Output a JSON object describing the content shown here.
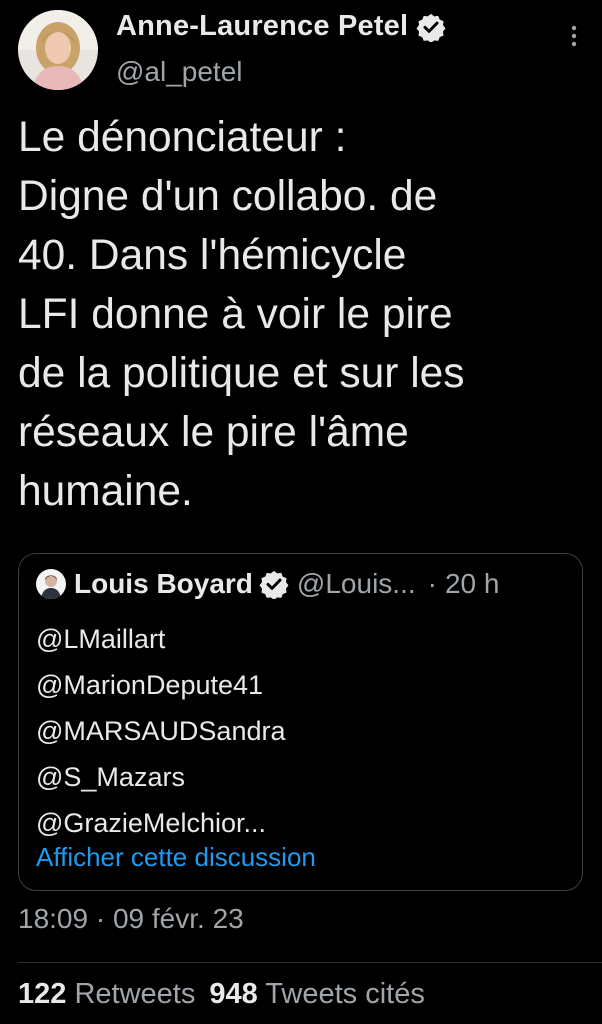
{
  "colors": {
    "background": "#000000",
    "text": "#e7e9ea",
    "secondary": "#a0a5aa",
    "link": "#1d9bf0",
    "border": "#3b3f44"
  },
  "tweet": {
    "author": {
      "name": "Anne-Laurence Petel",
      "handle": "@al_petel",
      "verified": true,
      "avatar_icon": "avatar-photo"
    },
    "more_icon": "more-vertical-icon",
    "text": "Le dénonciateur :\nDigne d'un collabo. de\n40. Dans l'hémicycle\nLFI donne à voir le pire\nde la politique et sur les\nréseaux le pire l'âme\nhumaine.",
    "quote": {
      "author_name": "Louis Boyard",
      "handle": "@Louis...",
      "separator": "·",
      "time": "20 h",
      "verified": true,
      "lines": [
        "@LMaillart",
        "@MarionDepute41",
        "@MARSAUDSandra",
        "@S_Mazars",
        "@GrazieMelchior..."
      ],
      "show_thread_label": "Afficher cette discussion"
    },
    "timestamp": "18:09 · 09 févr. 23",
    "stats": {
      "retweets_count": "122",
      "retweets_label": "Retweets",
      "quotes_count": "948",
      "quotes_label": "Tweets cités"
    }
  }
}
